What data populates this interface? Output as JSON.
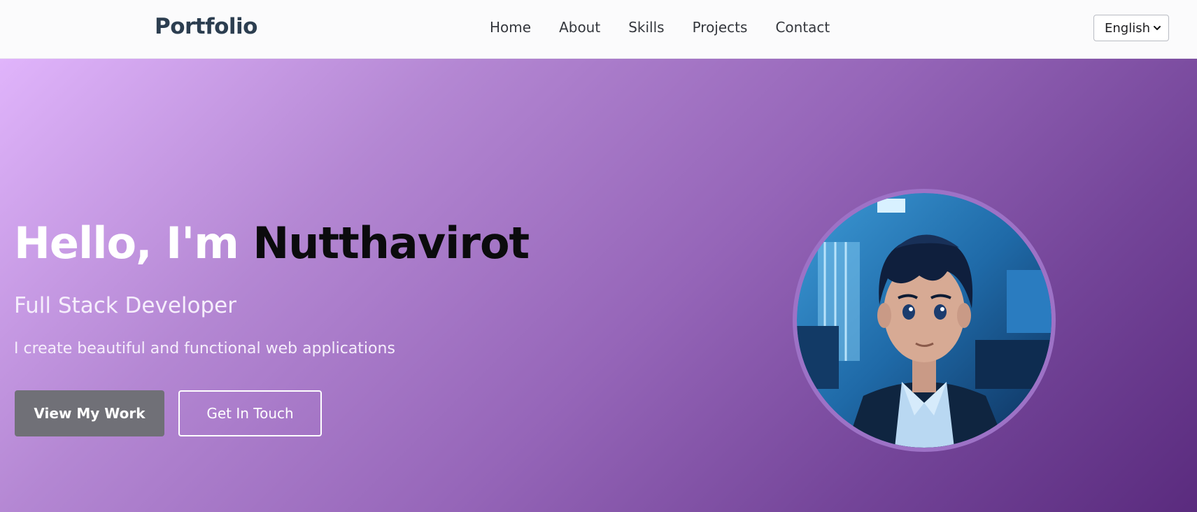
{
  "navbar": {
    "brand": "Portfolio",
    "links": [
      "Home",
      "About",
      "Skills",
      "Projects",
      "Contact"
    ],
    "language": {
      "selected": "English",
      "icon": "chevron-down-icon"
    }
  },
  "hero": {
    "greeting": "Hello, I'm",
    "name": "Nutthavirot",
    "subtitle": "Full Stack Developer",
    "description": "I create beautiful and functional web applications",
    "primary_button": "View My Work",
    "secondary_button": "Get In Touch",
    "avatar_alt": "Profile"
  },
  "colors": {
    "brand_text": "#2c3e50",
    "hero_gradient_start": "#e0b4fb",
    "hero_gradient_end": "#5a2b7e",
    "primary_button_bg": "#707077",
    "name_color": "#0b0b0d"
  }
}
